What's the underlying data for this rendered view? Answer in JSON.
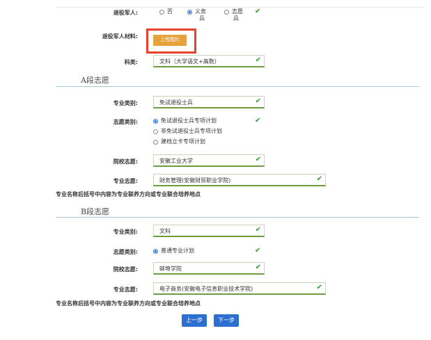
{
  "veteran": {
    "label": "退役军人:",
    "options": [
      {
        "label_line1": "否",
        "label_line2": "",
        "checked": false
      },
      {
        "label_line1": "义务",
        "label_line2": "兵",
        "checked": true
      },
      {
        "label_line1": "志愿",
        "label_line2": "兵",
        "checked": false
      }
    ]
  },
  "veteran_material": {
    "label": "退役军人材料:",
    "upload_label": "上传图片"
  },
  "subject": {
    "label": "科类:",
    "value": "文科（大学语文+高数）"
  },
  "section_a": {
    "title": "A段志愿",
    "major_category_label": "专业类别:",
    "major_category_value": "免试退役士兵",
    "plan_type_label": "志愿类别:",
    "plan_options": [
      "免试退役士兵专项计划",
      "非免试退役士兵专项计划",
      "建档立卡专项计划"
    ],
    "plan_selected_index": 0,
    "school_label": "院校志愿:",
    "school_value": "安徽工业大学",
    "major_label": "专业志愿:",
    "major_value": "财务管理(安徽财贸职业学院)",
    "note": "专业名称后括号中内容为专业联养方向或专业联合培养地点"
  },
  "section_b": {
    "title": "B段志愿",
    "major_category_label": "专业类别:",
    "major_category_value": "文科",
    "plan_type_label": "志愿类别:",
    "plan_options": [
      "普通专业计划"
    ],
    "plan_selected_index": 0,
    "school_label": "院校志愿:",
    "school_value": "蚌埠学院",
    "major_label": "专业志愿:",
    "major_value": "电子商务(安徽电子信息职业技术学院)",
    "note": "专业名称后括号中内容为专业联养方向或专业联合培养地点"
  },
  "nav": {
    "prev_label": "上一步",
    "next_label": "下一步"
  },
  "colors": {
    "accent_blue": "#2d6fd0",
    "upload_orange": "#e8a23c",
    "highlight_red": "#e8402a",
    "check_green": "#2f9a2f"
  },
  "icons": {
    "valid": "checkmark-icon"
  }
}
